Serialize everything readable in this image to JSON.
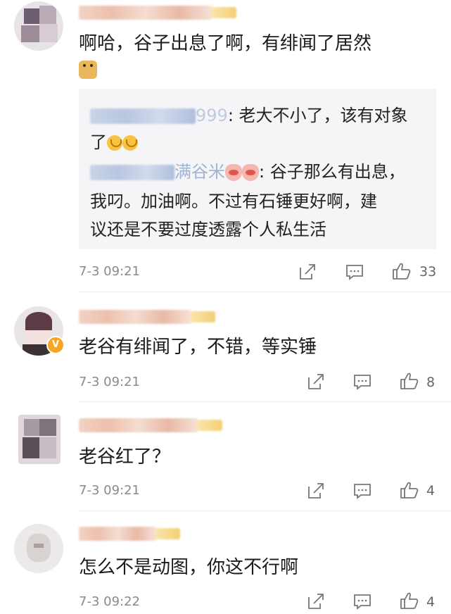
{
  "comments": [
    {
      "text": "啊哈，谷子出息了啊，有绯闻了居然",
      "emoji": "doge-emoji",
      "replies": [
        {
          "name_suffix": "999",
          "line1": ": 老大不小了，该有对象",
          "line2": "了",
          "emoji": "grin-emoji"
        },
        {
          "name_suffix": "满谷米",
          "line1": ": 谷子那么有出息，",
          "line2": "我叼。加油啊。不过有石锤更好啊，建",
          "line3": "议还是不要过度透露个人私生活",
          "emoji": "cat-emoji"
        }
      ],
      "time": "7-3 09:21",
      "likes": "33"
    },
    {
      "text": "老谷有绯闻了，不错，等实锤",
      "verified_badge": "V",
      "time": "7-3 09:21",
      "likes": "8"
    },
    {
      "text": "老谷红了？",
      "time": "7-3 09:21",
      "likes": "4"
    },
    {
      "text": "怎么不是动图，你这不行啊",
      "time": "7-3 09:22",
      "likes": "4"
    }
  ],
  "icons": [
    "share-icon",
    "comment-icon",
    "like-icon"
  ],
  "colors": {
    "link": "#5b7fb5",
    "meta": "#8a8a8a",
    "reply_bg": "#f5f5f7"
  }
}
